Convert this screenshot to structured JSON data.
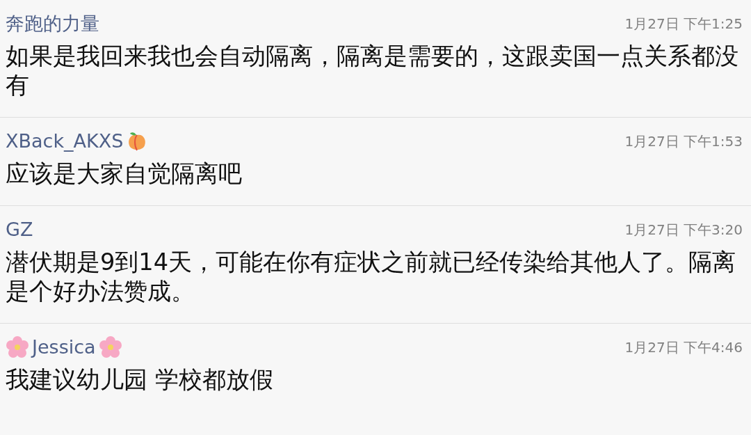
{
  "comments": [
    {
      "author": "奔跑的力量",
      "peach_after": false,
      "flowers_around": false,
      "time": "1月27日 下午1:25",
      "text": "如果是我回来我也会自动隔离，隔离是需要的，这跟卖国一点关系都没有"
    },
    {
      "author": "XBack_AKXS",
      "peach_after": true,
      "flowers_around": false,
      "time": "1月27日 下午1:53",
      "text": "应该是大家自觉隔离吧"
    },
    {
      "author": "GZ",
      "peach_after": false,
      "flowers_around": false,
      "time": "1月27日 下午3:20",
      "text": "潜伏期是9到14天，可能在你有症状之前就已经传染给其他人了。隔离是个好办法赞成。"
    },
    {
      "author": "Jessica",
      "peach_after": false,
      "flowers_around": true,
      "time": "1月27日 下午4:46",
      "text": "我建议幼儿园 学校都放假"
    }
  ]
}
